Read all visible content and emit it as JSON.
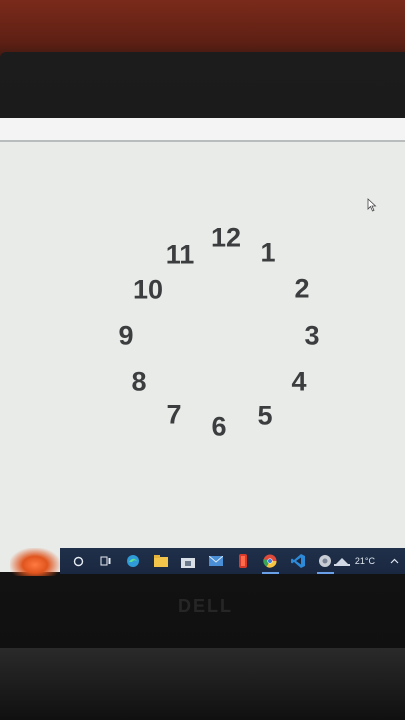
{
  "clock": {
    "numbers": [
      "12",
      "1",
      "2",
      "3",
      "4",
      "5",
      "6",
      "7",
      "8",
      "9",
      "10",
      "11"
    ]
  },
  "taskbar": {
    "weather_temp": "21°C",
    "icons": [
      "cortana-circle-icon",
      "task-view-icon",
      "edge-icon",
      "file-explorer-icon",
      "store-icon",
      "mail-icon",
      "office-icon",
      "chrome-icon",
      "vscode-icon",
      "app-icon"
    ]
  },
  "laptop": {
    "brand": "DELL"
  },
  "colors": {
    "screen_bg": "#e9ebe9",
    "numeral": "#3b3d3f",
    "taskbar": "#1f2e48"
  }
}
